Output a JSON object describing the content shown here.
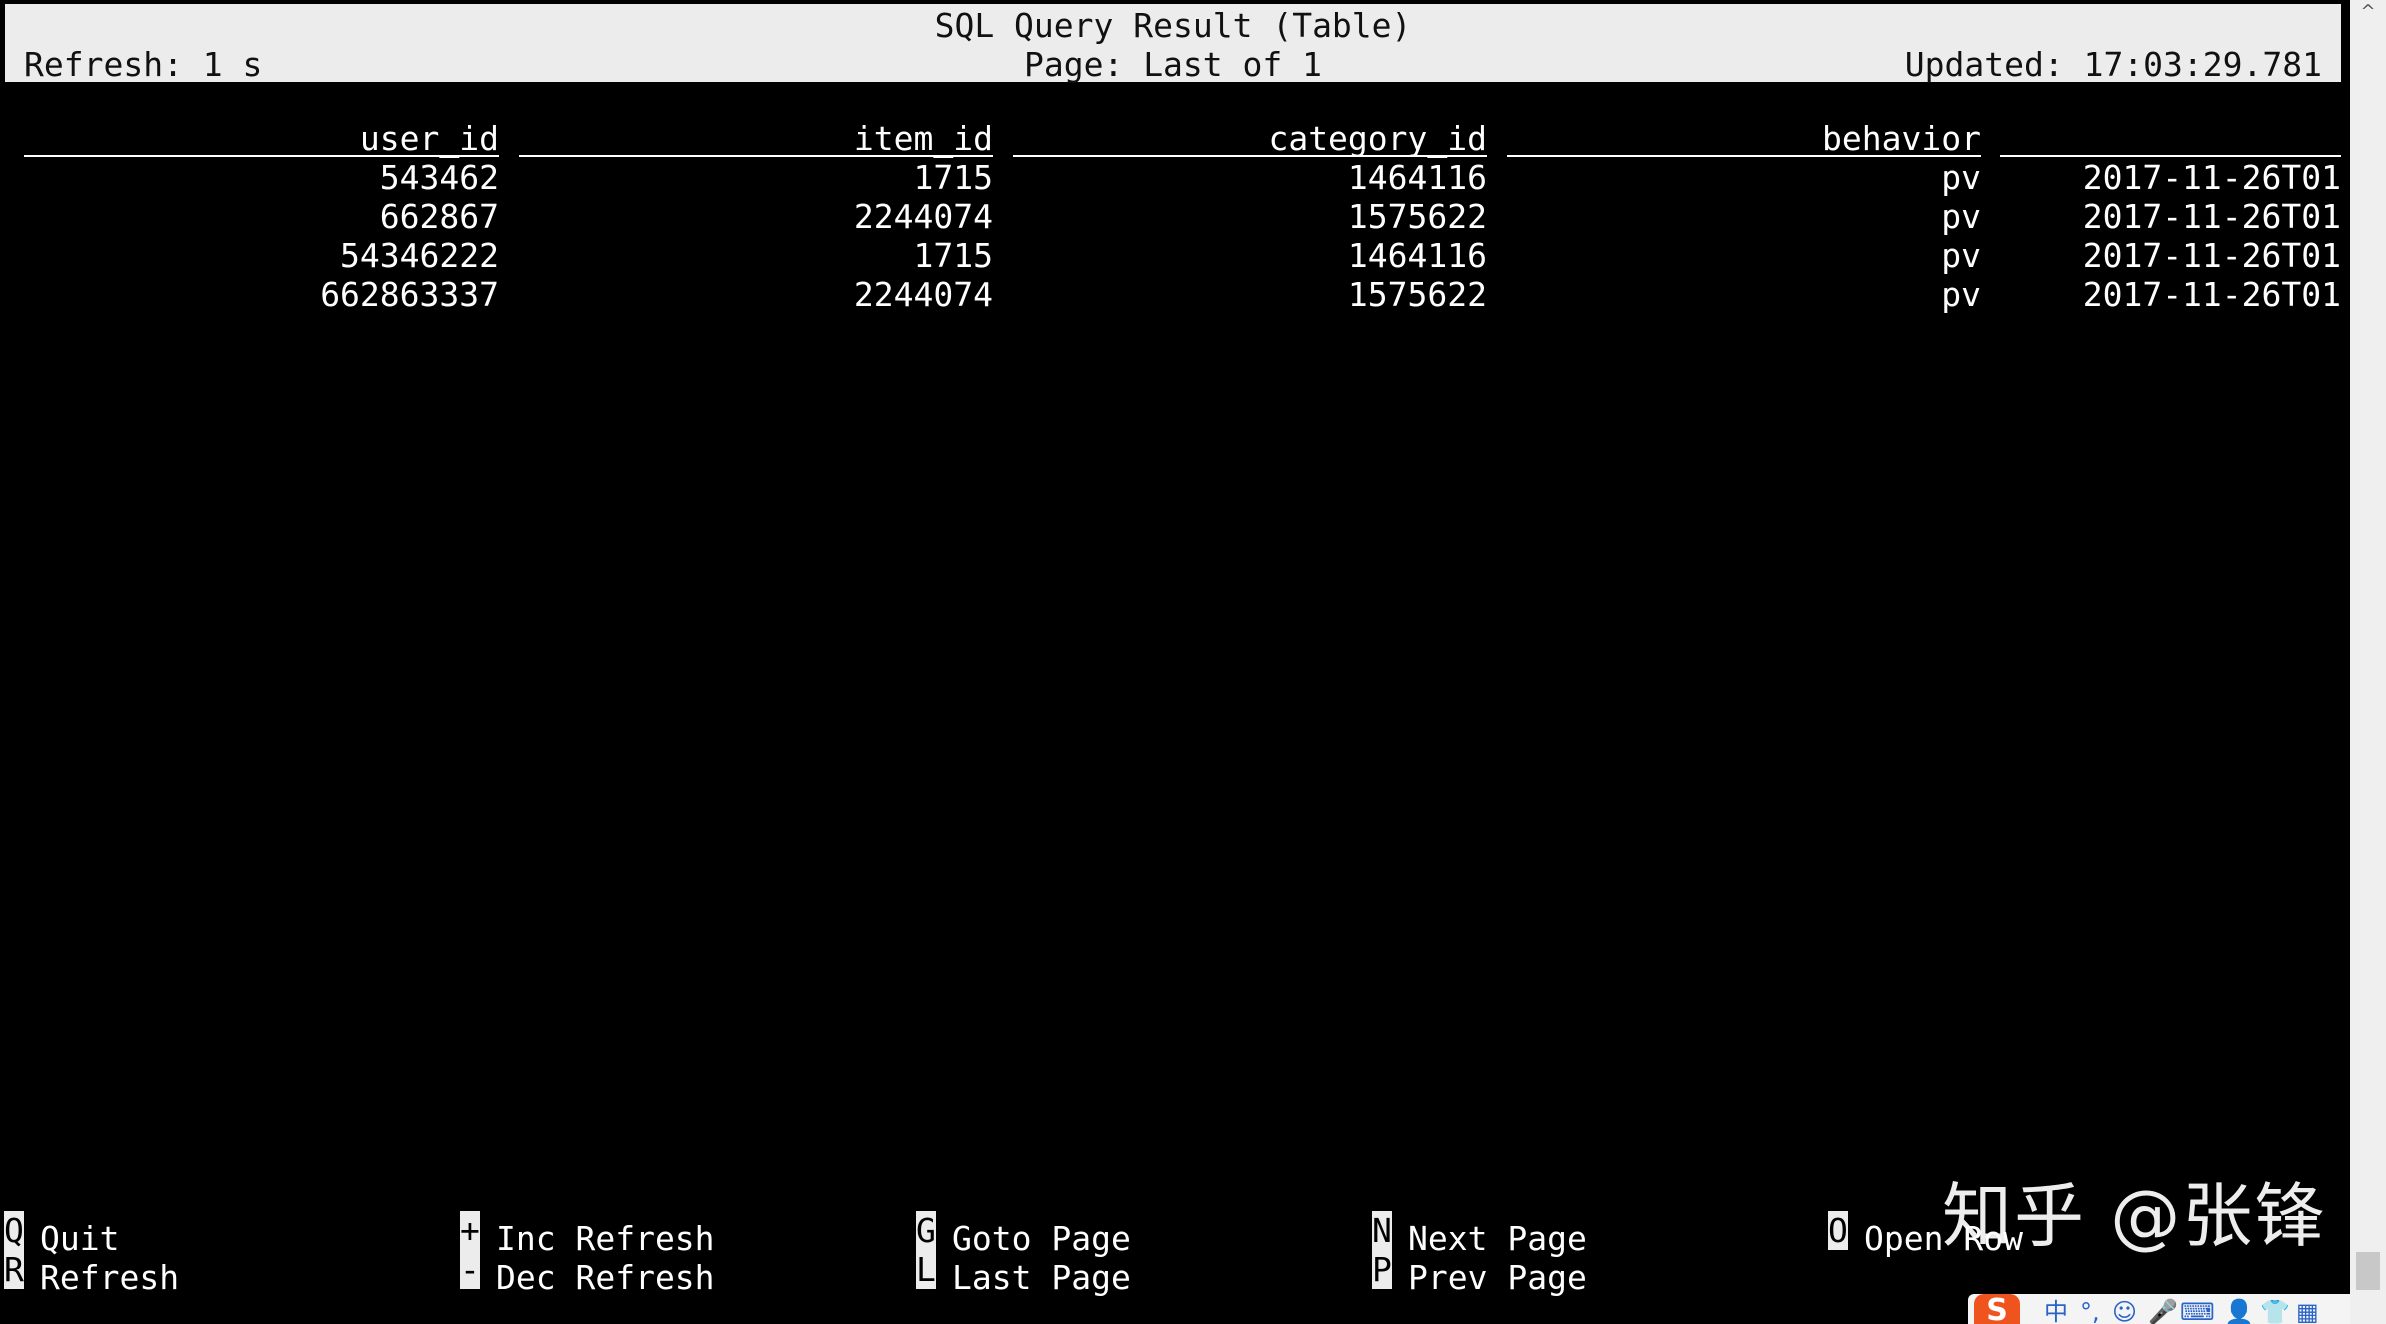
{
  "header": {
    "title": "SQL Query Result (Table)",
    "refresh": "Refresh: 1 s",
    "page": "Page: Last of 1",
    "updated": "Updated: 17:03:29.781"
  },
  "table": {
    "columns": [
      "user_id",
      "item_id",
      "category_id",
      "behavior",
      ""
    ],
    "rows": [
      [
        "543462",
        "1715",
        "1464116",
        "pv",
        "2017-11-26T01"
      ],
      [
        "662867",
        "2244074",
        "1575622",
        "pv",
        "2017-11-26T01"
      ],
      [
        "54346222",
        "1715",
        "1464116",
        "pv",
        "2017-11-26T01"
      ],
      [
        "662863337",
        "2244074",
        "1575622",
        "pv",
        "2017-11-26T01"
      ]
    ]
  },
  "footer": {
    "rows": [
      [
        {
          "key": "Q",
          "label": "Quit"
        },
        {
          "key": "+",
          "label": "Inc Refresh"
        },
        {
          "key": "G",
          "label": "Goto Page"
        },
        {
          "key": "N",
          "label": "Next Page"
        },
        {
          "key": "O",
          "label": "Open Row"
        }
      ],
      [
        {
          "key": "R",
          "label": "Refresh"
        },
        {
          "key": "-",
          "label": "Dec Refresh"
        },
        {
          "key": "L",
          "label": "Last Page"
        },
        {
          "key": "P",
          "label": "Prev Page"
        }
      ]
    ]
  },
  "watermark": "知乎 @张锋",
  "ime": {
    "logo": "S",
    "icons": [
      "中",
      "°,",
      "☺",
      "🎤",
      "⌨",
      "👤",
      "👕",
      "▦"
    ]
  },
  "scrollbar": {
    "up_arrow": "^"
  },
  "colors": {
    "background": "#000000",
    "header_bg": "#ececec",
    "text": "#ffffff",
    "ime_logo": "#f0541e"
  }
}
